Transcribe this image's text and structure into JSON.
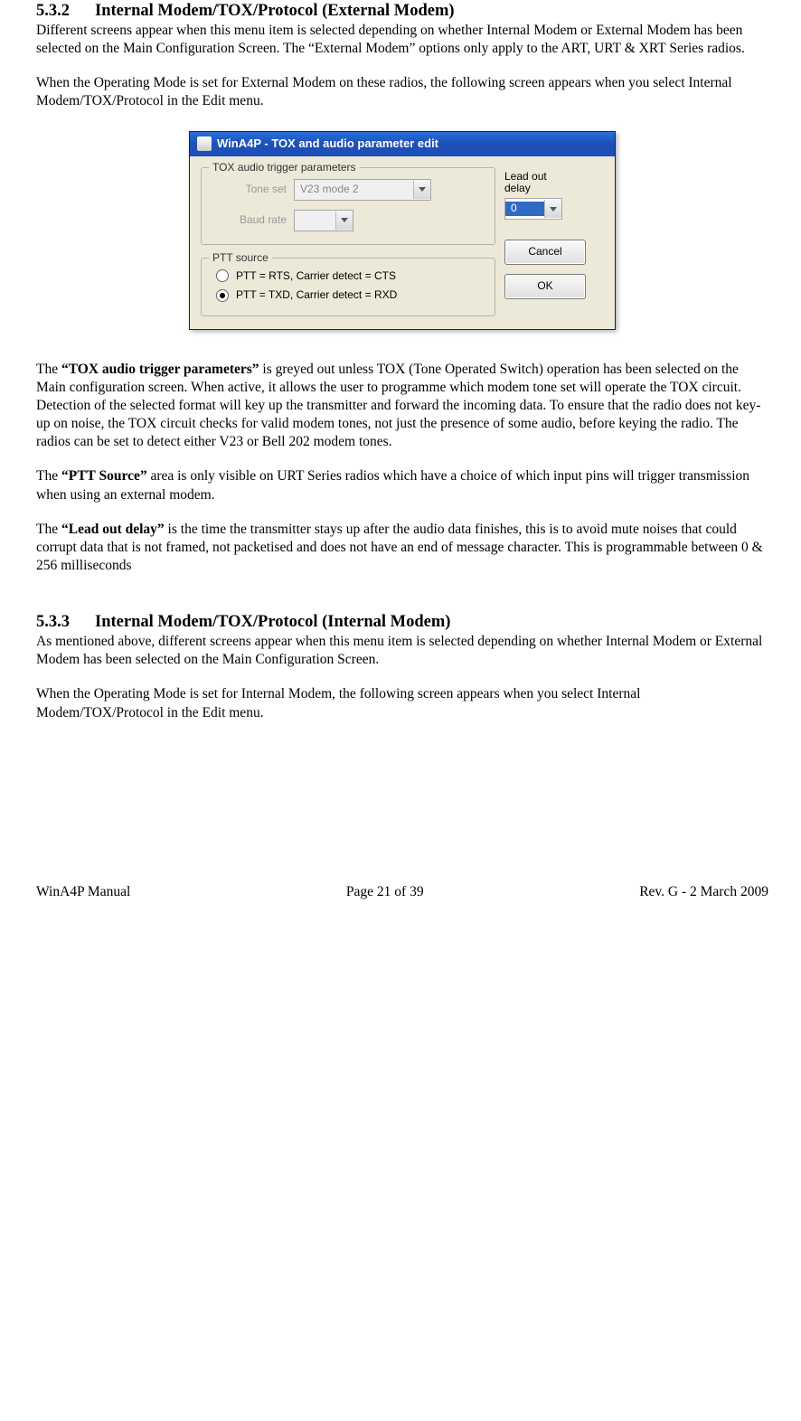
{
  "section1": {
    "number": "5.3.2",
    "title": "Internal Modem/TOX/Protocol (External Modem)",
    "para1": "Different screens appear when this menu item is selected depending on whether Internal Modem or External Modem has been selected on the Main Configuration Screen.  The “External Modem” options only apply to the ART, URT & XRT Series radios.",
    "para2": "When the Operating Mode is set for External Modem on these radios, the following screen appears when you select Internal Modem/TOX/Protocol in the Edit menu."
  },
  "dialog": {
    "title": "WinA4P - TOX and audio parameter edit",
    "group_tox": {
      "legend": "TOX audio trigger parameters",
      "tone_label": "Tone set",
      "tone_value": "V23 mode 2",
      "baud_label": "Baud rate",
      "baud_value": ""
    },
    "group_ptt": {
      "legend": "PTT source",
      "opt1": "PTT = RTS, Carrier detect = CTS",
      "opt2": "PTT = TXD, Carrier detect = RXD",
      "selected": 1
    },
    "leadout_label_l1": "Lead out",
    "leadout_label_l2": "delay",
    "leadout_value": "0",
    "btn_cancel": "Cancel",
    "btn_ok": "OK"
  },
  "body": {
    "p1a": "The ",
    "p1bold": "“TOX audio trigger  parameters”",
    "p1b": " is greyed out unless TOX (Tone Operated Switch) operation has been selected on the Main configuration screen.  When active, it allows the user to programme which modem tone set will operate the TOX circuit.  Detection of the selected format will key up the transmitter and forward the incoming data.  To ensure that the radio does not key-up on noise, the TOX circuit checks for valid modem tones, not just the presence of some audio, before keying the radio.  The radios can be set to detect either V23 or Bell 202 modem tones.",
    "p2a": "The ",
    "p2bold": "“PTT Source”",
    "p2b": " area is only visible on URT Series radios which have a choice of which input pins will trigger transmission when using an external modem.",
    "p3a": "The ",
    "p3bold": "“Lead out delay”",
    "p3b": " is the time the transmitter stays up after the audio data finishes, this is to avoid mute noises that could corrupt data that is not framed, not packetised and does not have an end of message character. This is programmable between 0 & 256 milliseconds"
  },
  "section2": {
    "number": "5.3.3",
    "title": "Internal Modem/TOX/Protocol (Internal Modem)",
    "para1": "As mentioned above, different screens appear when this menu item is selected depending on whether Internal Modem or External Modem has been selected on the Main Configuration Screen.",
    "para2": "When the Operating Mode is set for Internal Modem, the following screen appears when you select Internal Modem/TOX/Protocol in the Edit menu."
  },
  "footer": {
    "left": "WinA4P Manual",
    "center": "Page 21 of 39",
    "right": "Rev. G -  2 March 2009"
  }
}
